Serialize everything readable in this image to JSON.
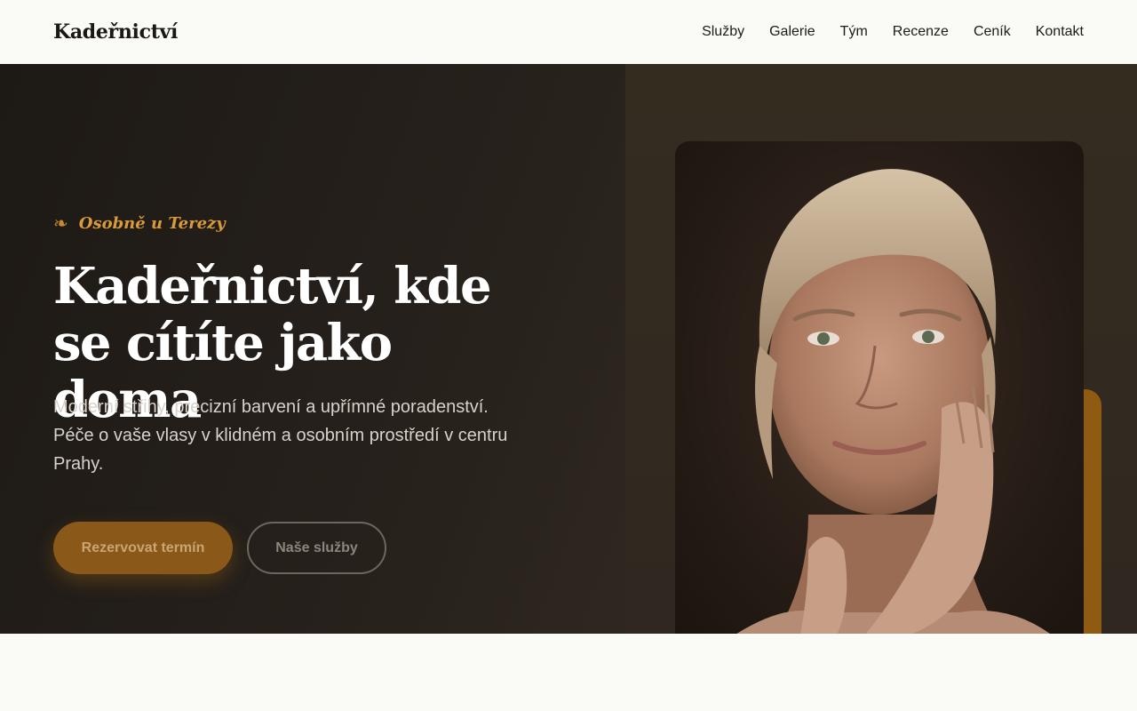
{
  "header": {
    "brand": "Kadeřnictví",
    "nav": [
      "Služby",
      "Galerie",
      "Tým",
      "Recenze",
      "Ceník",
      "Kontakt"
    ]
  },
  "hero": {
    "eyebrow_icon": "❧",
    "eyebrow": "Osobně u Terezy",
    "headline_line1": "Kadeřnictví, kde",
    "headline_line2": "se cítíte jako doma",
    "lead": "Moderní střihy, precizní barvení a upřímné poradenství. Péče o vaše vlasy v klidném a osobním prostředí v centru Prahy.",
    "primary_cta": "Rezervovat termín",
    "secondary_cta": "Naše služby"
  },
  "colors": {
    "accent": "#c88a2a",
    "hero_bg": "#28221d",
    "page_bg": "#fafaf6"
  }
}
